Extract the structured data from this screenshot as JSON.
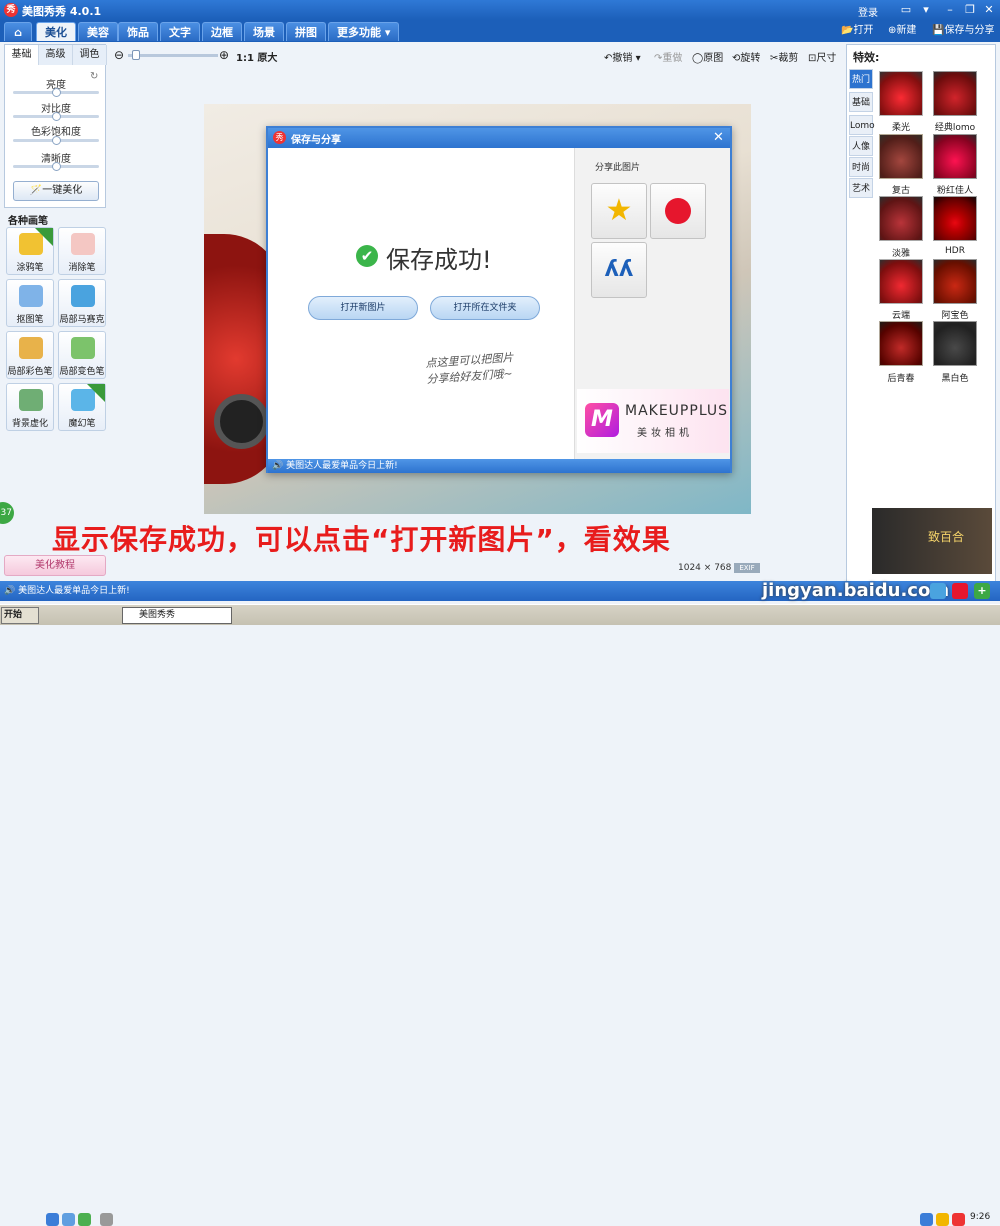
{
  "app": {
    "title": "美图秀秀 4.0.1",
    "logo_char": "秀",
    "login": "登录"
  },
  "window_controls": {
    "feedback": "▭",
    "menu": "▾",
    "minimize": "–",
    "maximize": "❐",
    "close": "✕"
  },
  "nav": {
    "home_icon": "⌂",
    "tabs": [
      "美化",
      "美容",
      "饰品",
      "文字",
      "边框",
      "场景",
      "拼图",
      "更多功能 ▾"
    ],
    "active_tab": "美化",
    "open": "打开",
    "new": "新建",
    "save_share": "保存与分享"
  },
  "left_panel": {
    "tabs": [
      "基础",
      "高级",
      "调色"
    ],
    "sliders": [
      {
        "label": "亮度",
        "level": 0.5
      },
      {
        "label": "对比度",
        "level": 0.5
      },
      {
        "label": "色彩饱和度",
        "level": 0.5
      },
      {
        "label": "清晰度",
        "level": 0.5
      }
    ],
    "one_click": "一键美化",
    "brushes_title": "各种画笔",
    "brushes": [
      {
        "label": "涂鸦笔",
        "color": "#f1c232",
        "ribbon": "升级"
      },
      {
        "label": "消除笔",
        "color": "#f4c7c3",
        "ribbon": ""
      },
      {
        "label": "抠图笔",
        "color": "#7fb3e8",
        "ribbon": ""
      },
      {
        "label": "局部马赛克",
        "color": "#4aa3df",
        "ribbon": ""
      },
      {
        "label": "局部彩色笔",
        "color": "#e8b24a",
        "ribbon": ""
      },
      {
        "label": "局部变色笔",
        "color": "#7cc36b",
        "ribbon": ""
      },
      {
        "label": "背景虚化",
        "color": "#6fae74",
        "ribbon": ""
      },
      {
        "label": "魔幻笔",
        "color": "#5bb5e8",
        "ribbon": "new"
      }
    ],
    "tutorial": "美化教程"
  },
  "canvas_toolbar": {
    "zoom_out": "⊖",
    "zoom_in": "⊕",
    "ratio": "1:1",
    "original_size": "原大",
    "undo": "撤销",
    "redo": "重做",
    "original": "原图",
    "rotate": "旋转",
    "crop": "裁剪",
    "size": "尺寸"
  },
  "dialog": {
    "title": "保存与分享",
    "close": "✕",
    "check": "✔",
    "success": "保存成功!",
    "open_new": "打开新图片",
    "open_folder": "打开所在文件夹",
    "hint_line1": "点这里可以把图片",
    "hint_line2": "分享给好友们哦~",
    "share_label": "分享此图片",
    "share_icons": [
      "star-share",
      "weibo-share",
      "renren-share"
    ],
    "ad_logo": "M",
    "ad_brand": "MAKEUPPLUS",
    "ad_sub": "美妆相机",
    "status": "美图达人最爱单品今日上新!"
  },
  "right_panel": {
    "title": "特效:",
    "tabs": [
      "热门",
      "基础",
      "Lomo",
      "人像",
      "时尚",
      "艺术"
    ],
    "active_tab": "热门",
    "effects": [
      "柔光",
      "经典lomo",
      "复古",
      "粉红佳人",
      "淡雅",
      "HDR",
      "云端",
      "阿宝色",
      "后青春",
      "黑白色"
    ]
  },
  "caption": "显示保存成功，可以点击“打开新图片”，看效果",
  "image_info": {
    "width": "1024",
    "x": "×",
    "height": "768",
    "exif": "EXIF"
  },
  "bottom_bar": {
    "news": "美图达人最爱单品今日上新!",
    "watermark": "jingyan.baidu.com"
  },
  "right_ad": {
    "text": "致百合"
  },
  "taskbar": {
    "start": "开始",
    "app": "美图秀秀",
    "time": "9:26"
  },
  "colors": {
    "accent": "#2d73cf",
    "caption": "#e81c1c",
    "success": "#3bb54a"
  }
}
